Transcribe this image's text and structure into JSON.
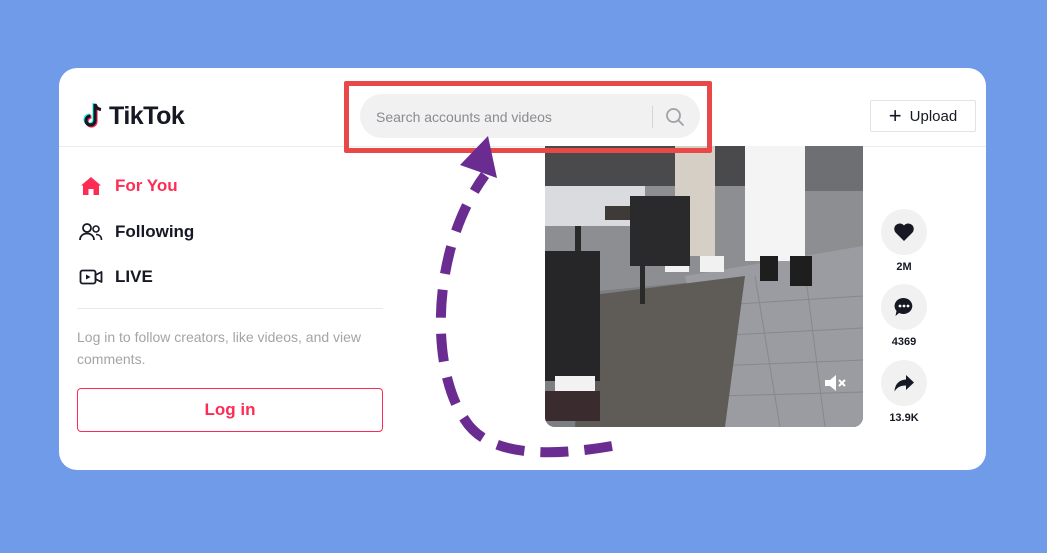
{
  "header": {
    "logo_text": "TikTok",
    "search_placeholder": "Search accounts and videos",
    "upload_label": "Upload"
  },
  "sidebar": {
    "items": [
      {
        "label": "For You",
        "icon": "home-icon",
        "active": true
      },
      {
        "label": "Following",
        "icon": "users-icon",
        "active": false
      },
      {
        "label": "LIVE",
        "icon": "live-icon",
        "active": false
      }
    ],
    "login_prompt": "Log in to follow creators, like videos, and view comments.",
    "login_label": "Log in"
  },
  "actions": {
    "likes": "2M",
    "comments": "4369",
    "shares": "13.9K"
  },
  "colors": {
    "brand_red": "#fe2c55",
    "highlight": "#e94848",
    "arrow": "#6a2c91",
    "background": "#6f9be9"
  }
}
